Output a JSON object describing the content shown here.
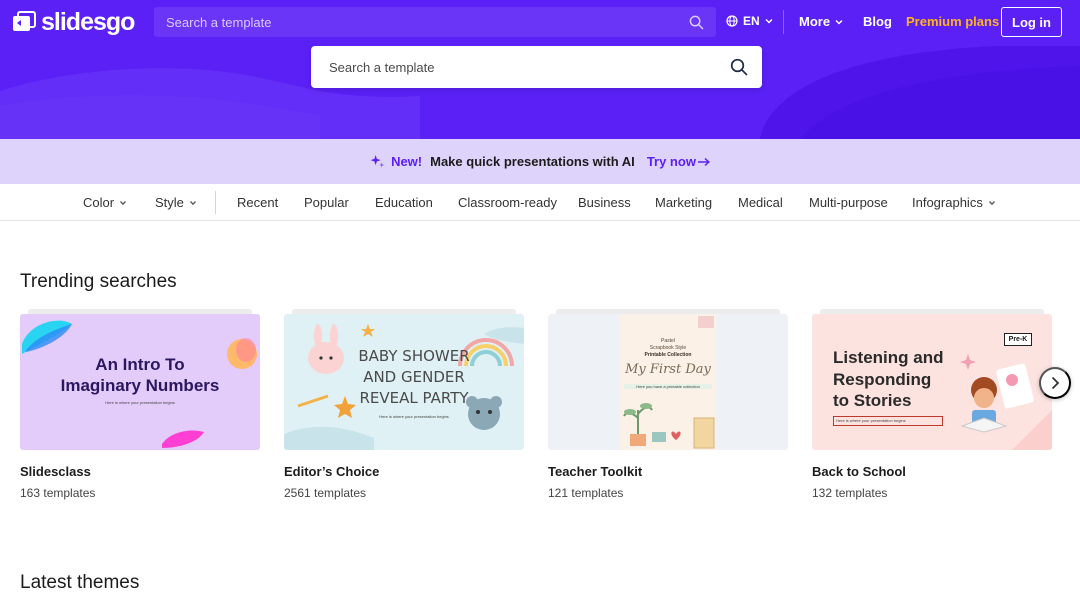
{
  "header": {
    "logo_text": "slidesgo",
    "search_placeholder": "Search a template",
    "language": "EN",
    "more_label": "More",
    "blog_label": "Blog",
    "premium_label": "Premium plans",
    "login_label": "Log in",
    "brand_color": "#5a20f5",
    "premium_color": "#ffb31f"
  },
  "hero": {
    "search_placeholder": "Search a template"
  },
  "ai_banner": {
    "new_label": "New!",
    "text": "Make quick presentations with AI",
    "cta_label": "Try now"
  },
  "category_nav": {
    "filters": [
      "Color",
      "Style"
    ],
    "categories": [
      "Recent",
      "Popular",
      "Education",
      "Classroom-ready",
      "Business",
      "Marketing",
      "Medical",
      "Multi-purpose",
      "Infographics"
    ]
  },
  "trending": {
    "title": "Trending searches",
    "cards": [
      {
        "title": "Slidesclass",
        "count": "163 templates",
        "thumb": {
          "line1": "An Intro To",
          "line2": "Imaginary Numbers",
          "sub": "Here is where your presentation begins"
        }
      },
      {
        "title": "Editor’s Choice",
        "count": "2561 templates",
        "thumb": {
          "line1": "BABY SHOWER",
          "line2": "AND GENDER",
          "line3": "REVEAL PARTY",
          "sub": "Here is where your presentation begins"
        }
      },
      {
        "title": "Teacher Toolkit",
        "count": "121 templates",
        "thumb": {
          "line1": "Pastel",
          "line2": "Scrapbook Style",
          "line3": "Printable Collection",
          "line4": "My First Day",
          "sub": "Here you have a printable collection"
        }
      },
      {
        "title": "Back to School",
        "count": "132 templates",
        "thumb": {
          "line1": "Listening and",
          "line2": "Responding",
          "line3": "to Stories",
          "sub": "Here is where your presentation begins",
          "badge": "Pre-K"
        }
      }
    ]
  },
  "latest": {
    "title": "Latest themes"
  }
}
